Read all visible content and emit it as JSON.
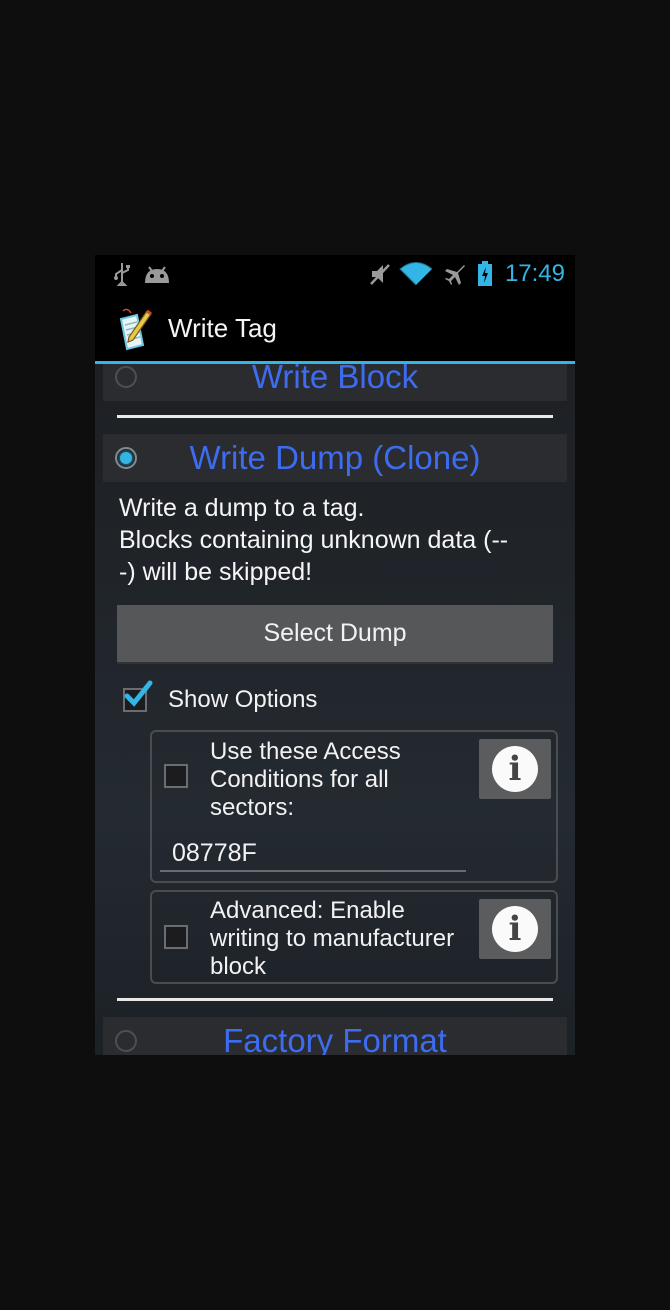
{
  "status_bar": {
    "time": "17:49",
    "icons": [
      "usb-icon",
      "android-debug-icon",
      "mute-icon",
      "wifi-icon",
      "airplane-icon",
      "battery-charging-icon"
    ]
  },
  "action_bar": {
    "title": "Write Tag",
    "icon": "tag-write-app-icon"
  },
  "options": {
    "write_block": "Write Block",
    "write_dump": "Write Dump (Clone)",
    "factory_format": "Factory Format",
    "selected": "write_dump"
  },
  "write_dump": {
    "description_line1": "Write a dump to a tag.",
    "description_line2": "Blocks containing unknown data (--",
    "description_line3": "-) will be skipped!",
    "select_button": "Select Dump",
    "show_options_label": "Show Options",
    "show_options_checked": true,
    "access_conditions_label_1": "Use these Access",
    "access_conditions_label_2": "Conditions for all",
    "access_conditions_label_3": "sectors:",
    "access_conditions_value": "08778F",
    "access_conditions_checked": false,
    "advanced_label_1": "Advanced: Enable",
    "advanced_label_2": "writing to manufacturer",
    "advanced_label_3": "block",
    "advanced_checked": false,
    "info_glyph": "i"
  },
  "colors": {
    "accent": "#33b5e5",
    "option_label": "#3d6cf0"
  }
}
